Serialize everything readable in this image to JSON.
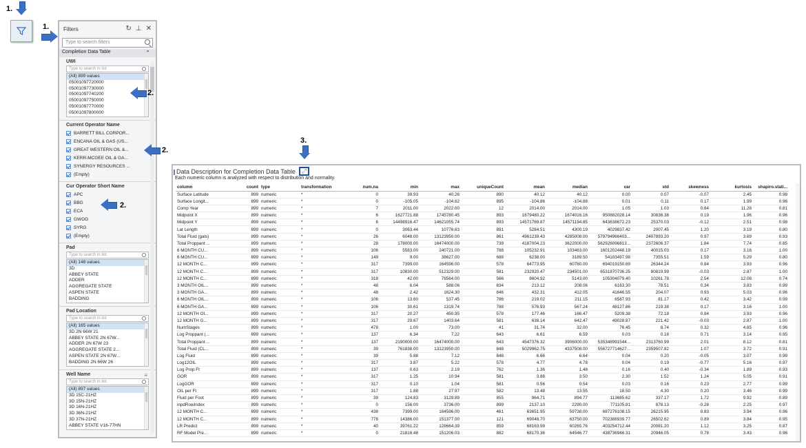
{
  "annotations": {
    "step1_top": "1.",
    "step1_side": "1.",
    "step2_a": "2.",
    "step2_b": "2.",
    "step2_c": "2.",
    "step3": "3."
  },
  "filters_panel": {
    "title": "Filters",
    "search_placeholder": "Type to search filters",
    "table_section": "Completion Data Table",
    "groups": {
      "uwi": {
        "title": "UWI",
        "search_placeholder": "Type to search in list",
        "items": [
          "(All) 899 values",
          "05001097720000",
          "05001097730000",
          "05001097740200",
          "05001097750000",
          "05001097770000",
          "05001097800000"
        ]
      },
      "current_operator": {
        "title": "Current Operator Name",
        "items": [
          "BARRETT BILL CORPOR...",
          "ENCANA OIL & GAS (US...",
          "GREAT WESTERN OIL &...",
          "KERR-MCGEE OIL & GA...",
          "SYNERGY RESOURCES ...",
          "(Empty)"
        ]
      },
      "cur_operator_short": {
        "title": "Cur Operator Short Name",
        "items": [
          "APC",
          "BBG",
          "ECA",
          "GWOG",
          "SYRG",
          "(Empty)"
        ]
      },
      "pad": {
        "title": "Pad",
        "search_placeholder": "Type to search in list",
        "items": [
          "(All) 148 values",
          "3D",
          "ABBEY STATE",
          "ADDER",
          "AGGREGATE STATE",
          "ASPEN STATE",
          "BADDING"
        ]
      },
      "pad_location": {
        "title": "Pad Location",
        "search_placeholder": "Type to search in list",
        "items": [
          "(All) 165 values",
          "3D 2N 66W 21",
          "ABBEY STATE 2N 67W...",
          "ADDER 2N 67W 23",
          "AGGREGATE STATE 2...",
          "ASPEN STATE 2N 67W...",
          "BADDING 2N 66W 26"
        ]
      },
      "well_name": {
        "title": "Well Name",
        "search_placeholder": "Type to search in list",
        "items": [
          "(All) 897 values",
          "3D 15C-21HZ",
          "3D 15N-21HZ",
          "3D 16N-21HZ",
          "3D 36N-21HZ",
          "3D 37N-21HZ",
          "ABBEY STATE V16-77HN"
        ]
      }
    }
  },
  "data_description": {
    "title": "Data Description for Completion Data Table",
    "subtitle": "Each numeric column is analyzed with respect to distribution and normality.",
    "headers": [
      "column",
      "count",
      "type",
      "transformation",
      "num.na",
      "min",
      "max",
      "uniqueCount",
      "mean",
      "median",
      "var",
      "std",
      "skewness",
      "kurtosis",
      "shapiro.stati..."
    ],
    "rows": [
      [
        "Surface Latitude",
        "899",
        "numeric",
        "*",
        "0",
        "39.93",
        "40.26",
        "890",
        "40.12",
        "40.12",
        "0.00",
        "0.07",
        "-0.07",
        "2.45",
        "0.98"
      ],
      [
        "Surface Longit...",
        "899",
        "numeric",
        "*",
        "0",
        "-105.05",
        "-104.62",
        "895",
        "-104.86",
        "-104.88",
        "0.01",
        "0.11",
        "0.17",
        "1.99",
        "0.96"
      ],
      [
        "Comp Year",
        "899",
        "numeric",
        "*",
        "7",
        "2011.00",
        "2022.00",
        "12",
        "2014.00",
        "2014.00",
        "1.05",
        "1.03",
        "0.64",
        "11.28",
        "0.81"
      ],
      [
        "Midpoint X",
        "899",
        "numeric",
        "*",
        "6",
        "1627721.88",
        "1745780.45",
        "893",
        "1679480.22",
        "1674016.16",
        "950882028.14",
        "30836.38",
        "0.19",
        "1.96",
        "0.96"
      ],
      [
        "Midpoint Y",
        "899",
        "numeric",
        "*",
        "6",
        "14498916.47",
        "14621055.74",
        "893",
        "14571769.87",
        "14571194.85",
        "643638672.23",
        "25370.03",
        "-0.12",
        "2.51",
        "0.98"
      ],
      [
        "Lat Length",
        "899",
        "numeric",
        "*",
        "0",
        "3063.44",
        "10776.63",
        "891",
        "5284.51",
        "4300.19",
        "4029837.42",
        "2007.45",
        "1.20",
        "3.19",
        "0.80"
      ],
      [
        "Total Fluid (gals)",
        "899",
        "numeric",
        "*",
        "26",
        "6048.00",
        "13123950.00",
        "861",
        "4961239.43",
        "4285008.00",
        "579794966403...",
        "2407893.20",
        "0.97",
        "3.69",
        "0.93"
      ],
      [
        "Total Proppant ...",
        "899",
        "numeric",
        "*",
        "28",
        "178000.00",
        "16474000.00",
        "739",
        "4187004.23",
        "3622000.00",
        "562926096813...",
        "2372606.37",
        "1.84",
        "7.74",
        "0.85"
      ],
      [
        "6 MONTH CU...",
        "899",
        "numeric",
        "*",
        "106",
        "5583.00",
        "240721.00",
        "788",
        "105232.91",
        "103463.00",
        "1601202448.19",
        "40015.03",
        "0.17",
        "3.16",
        "1.00"
      ],
      [
        "6 MONTH CU...",
        "899",
        "numeric",
        "*",
        "149",
        "9.00",
        "38627.00",
        "688",
        "6238.00",
        "3189.50",
        "54103497.98",
        "7355.51",
        "1.59",
        "5.29",
        "0.80"
      ],
      [
        "12 MONTH C...",
        "899",
        "numeric",
        "*",
        "317",
        "7399.00",
        "164596.00",
        "578",
        "64773.95",
        "60760.00",
        "694019150.69",
        "26344.24",
        "0.84",
        "3.93",
        "0.96"
      ],
      [
        "12 MONTH C...",
        "899",
        "numeric",
        "*",
        "317",
        "10830.00",
        "512329.00",
        "581",
        "232920.47",
        "234501.00",
        "6531870736.25",
        "80819.99",
        "-0.03",
        "2.87",
        "1.00"
      ],
      [
        "12 MONTH C...",
        "899",
        "numeric",
        "*",
        "318",
        "42.00",
        "78564.00",
        "566",
        "8604.92",
        "5143.00",
        "105304079.40",
        "10261.78",
        "2.54",
        "12.08",
        "0.74"
      ],
      [
        "3 MONTH OIL...",
        "899",
        "numeric",
        "*",
        "48",
        "6.04",
        "588.06",
        "834",
        "213.12",
        "208.06",
        "6163.30",
        "78.51",
        "0.34",
        "3.83",
        "0.99"
      ],
      [
        "3 MONTH GA...",
        "899",
        "numeric",
        "*",
        "48",
        "2.42",
        "1624.30",
        "846",
        "432.31",
        "412.05",
        "41646.55",
        "204.07",
        "0.93",
        "5.03",
        "0.96"
      ],
      [
        "6 MONTH OIL...",
        "899",
        "numeric",
        "*",
        "106",
        "13.60",
        "537.45",
        "786",
        "219.02",
        "211.15",
        "6587.93",
        "81.17",
        "0.42",
        "3.42",
        "0.99"
      ],
      [
        "6 MONTH GA...",
        "899",
        "numeric",
        "*",
        "106",
        "30.61",
        "1319.74",
        "788",
        "576.93",
        "567.24",
        "48127.86",
        "219.38",
        "0.17",
        "3.16",
        "1.00"
      ],
      [
        "12 MONTH OI...",
        "899",
        "numeric",
        "*",
        "317",
        "20.27",
        "450.95",
        "578",
        "177.46",
        "166.47",
        "5209.38",
        "72.18",
        "0.84",
        "3.93",
        "0.96"
      ],
      [
        "12 MONTH G...",
        "899",
        "numeric",
        "*",
        "317",
        "29.67",
        "1403.64",
        "581",
        "638.14",
        "642.47",
        "49028.87",
        "221.42",
        "-0.03",
        "2.87",
        "1.00"
      ],
      [
        "NumStages",
        "899",
        "numeric",
        "*",
        "478",
        "1.00",
        "73.00",
        "41",
        "31.74",
        "32.00",
        "76.45",
        "8.74",
        "0.32",
        "4.65",
        "0.96"
      ],
      [
        "Log Proppant (...",
        "899",
        "numeric",
        "*",
        "137",
        "6.34",
        "7.22",
        "643",
        "6.61",
        "6.59",
        "0.03",
        "0.18",
        "0.71",
        "3.14",
        "0.95"
      ],
      [
        "Total Proppant ...",
        "899",
        "numeric",
        "*",
        "137",
        "2190000.00",
        "16474000.00",
        "643",
        "4547376.32",
        "3906000.00",
        "535348991544...",
        "2313760.99",
        "2.01",
        "8.12",
        "0.81"
      ],
      [
        "Total Fluid (CL...",
        "899",
        "numeric",
        "*",
        "39",
        "761838.00",
        "13123950.00",
        "848",
        "5029962.75",
        "4337508.00",
        "556727714627...",
        "2359507.82",
        "1.07",
        "3.72",
        "0.91"
      ],
      [
        "Log Fluid",
        "899",
        "numeric",
        "*",
        "39",
        "5.88",
        "7.12",
        "848",
        "6.66",
        "6.64",
        "0.04",
        "0.20",
        "-0.05",
        "3.07",
        "0.99"
      ],
      [
        "Log12OIL",
        "899",
        "numeric",
        "*",
        "317",
        "3.87",
        "5.22",
        "578",
        "4.77",
        "4.78",
        "0.04",
        "0.19",
        "-0.77",
        "5.16",
        "0.97"
      ],
      [
        "Log Prop Ft",
        "899",
        "numeric",
        "*",
        "137",
        "0.63",
        "2.19",
        "762",
        "1.36",
        "1.48",
        "0.16",
        "0.40",
        "-0.34",
        "1.89",
        "0.93"
      ],
      [
        "GOR",
        "899",
        "numeric",
        "*",
        "317",
        "1.25",
        "10.94",
        "581",
        "3.88",
        "3.50",
        "2.30",
        "1.52",
        "1.24",
        "5.05",
        "0.91"
      ],
      [
        "LogGOR",
        "899",
        "numeric",
        "*",
        "317",
        "0.10",
        "1.04",
        "581",
        "0.56",
        "0.54",
        "0.03",
        "0.16",
        "0.23",
        "2.77",
        "0.99"
      ],
      [
        "OIL per Ft",
        "899",
        "numeric",
        "*",
        "317",
        "1.88",
        "27.97",
        "582",
        "13.48",
        "13.55",
        "18.50",
        "4.30",
        "0.20",
        "3.46",
        "0.99"
      ],
      [
        "Fluid per Foot",
        "899",
        "numeric",
        "*",
        "39",
        "124.83",
        "3129.89",
        "855",
        "964.71",
        "894.77",
        "113685.62",
        "337.17",
        "1.72",
        "9.92",
        "0.89"
      ],
      [
        "inpdRowIndex",
        "899",
        "numeric",
        "*",
        "0",
        "156.00",
        "3736.00",
        "899",
        "2137.10",
        "2290.00",
        "771105.81",
        "878.13",
        "-0.28",
        "2.25",
        "0.97"
      ],
      [
        "12 MONTH C...",
        "899",
        "numeric",
        "*",
        "438",
        "7399.00",
        "164596.00",
        "461",
        "63651.95",
        "59738.00",
        "687276108.15",
        "26215.95",
        "0.83",
        "3.94",
        "0.96"
      ],
      [
        "12 MONTH C...",
        "899",
        "numeric",
        "*",
        "778",
        "14386.00",
        "151377.00",
        "121",
        "69048.70",
        "63750.00",
        "702388939.77",
        "26502.62",
        "0.89",
        "3.84",
        "0.95"
      ],
      [
        "LR Predict",
        "899",
        "numeric",
        "*",
        "40",
        "39761.22",
        "128664.39",
        "859",
        "68163.99",
        "60265.76",
        "403254712.44",
        "20081.20",
        "1.12",
        "3.25",
        "0.87"
      ],
      [
        "RF Model Pre...",
        "899",
        "numeric",
        "*",
        "0",
        "21816.48",
        "151206.03",
        "882",
        "68170.36",
        "64546.77",
        "438736946.31",
        "20946.05",
        "0.78",
        "3.43",
        "0.96"
      ]
    ]
  }
}
